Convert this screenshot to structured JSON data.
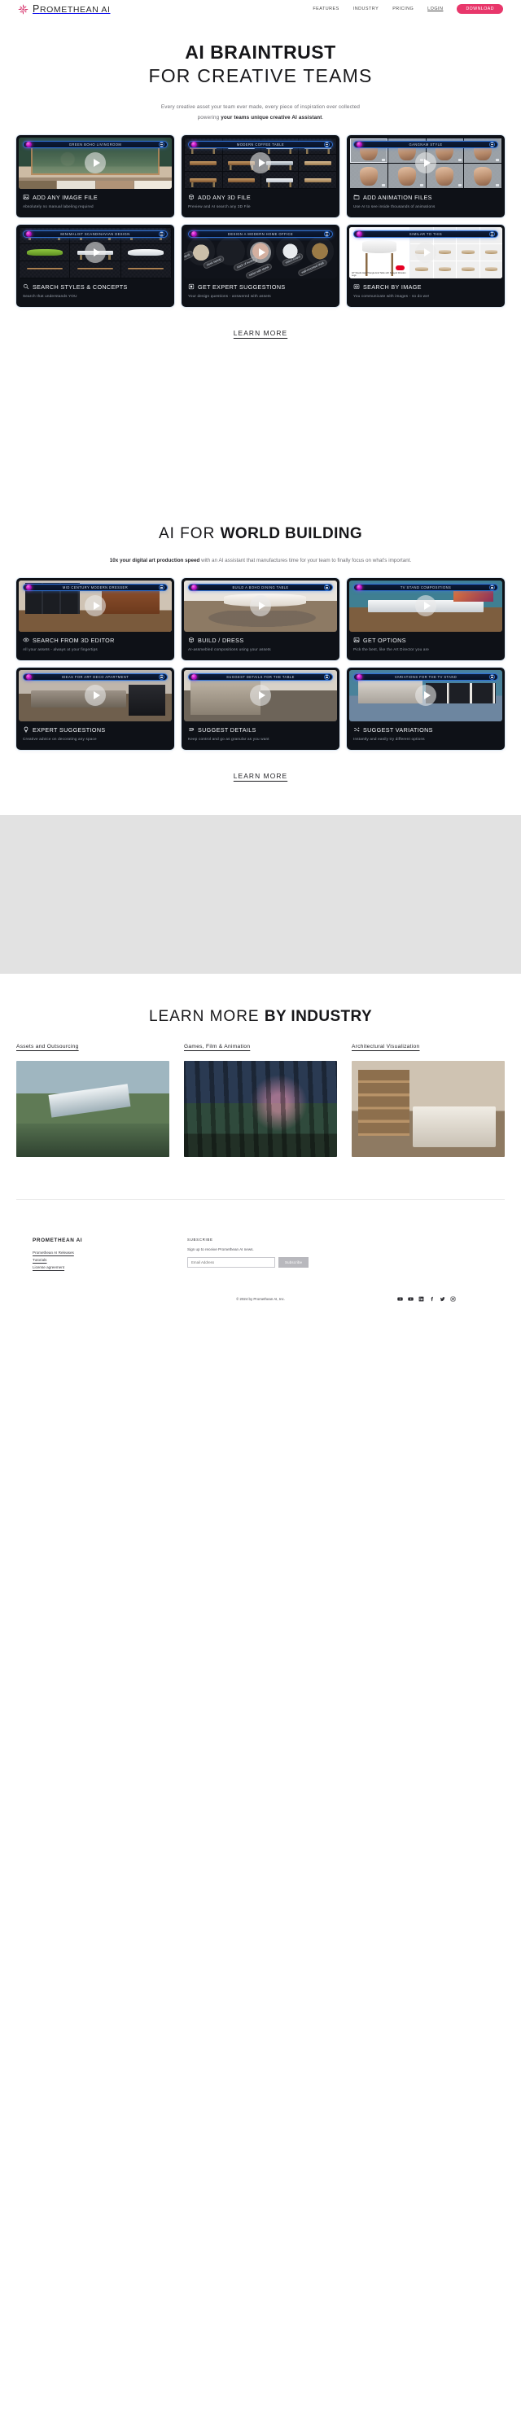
{
  "header": {
    "brand": "Promethean AI",
    "logo_icon": "promethean-flake-icon",
    "accent": "#e8376b",
    "nav": [
      {
        "label": "Features",
        "name": "features"
      },
      {
        "label": "Industry",
        "name": "industry"
      },
      {
        "label": "Pricing",
        "name": "pricing"
      },
      {
        "label": "Login",
        "name": "login",
        "underlined": true
      }
    ],
    "cta": "Download"
  },
  "hero": {
    "title_line1": "AI BRAINTRUST",
    "title_line2": "FOR CREATIVE TEAMS",
    "lede_part1": "Every creative asset your team ever made, every piece of inspiration ever collected",
    "lede_part2": "powering ",
    "lede_bold": "your teams unique creative AI assistant",
    "lede_part3": "."
  },
  "braintrust_cards": [
    {
      "window_title": "Green Boho Livingroom",
      "title": "Add Any Image File",
      "subtitle": "Absolutely no manual labeling required",
      "icon": "image-icon"
    },
    {
      "window_title": "Modern Coffee Table",
      "title": "Add Any 3D File",
      "subtitle": "Preview and AI search any 3D File",
      "icon": "cube-icon"
    },
    {
      "window_title": "Gangnam Style",
      "title": "Add Animation Files",
      "subtitle": "Use AI to see inside thousands of animations",
      "icon": "clapperboard-icon"
    },
    {
      "window_title": "Minimalist Scandinavian Design",
      "title": "Search Styles & Concepts",
      "subtitle": "Search that understands YOU",
      "icon": "magnifier-icon"
    },
    {
      "window_title": "Design A Modern Home Office",
      "title": "Get Expert Suggestions",
      "subtitle": "Your design questions - answered with assets",
      "icon": "aperture-icon"
    },
    {
      "window_title": "Similar To This",
      "title": "Search By Image",
      "subtitle": "You communicate with images - so do we!",
      "icon": "eye-scan-icon"
    }
  ],
  "braintrust_learn_more": "LEARN MORE",
  "world": {
    "title_light": "AI FOR ",
    "title_bold": "WORLD BUILDING",
    "sub_bold": "10x your digital art production speed",
    "sub_rest": " with an AI assistant that manufactures time for your team to finally focus on what's important."
  },
  "world_cards": [
    {
      "window_title": "Mid Century Modern Dresser",
      "title": "Search From 3D Editor",
      "subtitle": "All your assets - always at your fingertips",
      "icon": "eye-icon"
    },
    {
      "window_title": "Build A Boho Dining Table",
      "title": "Build / Dress",
      "subtitle": "AI-assmebled compositions using your assets",
      "icon": "cube-icon"
    },
    {
      "window_title": "TV Stand Compositions",
      "title": "Get Options",
      "subtitle": "Pick the best, like the Art Director you are",
      "icon": "image-icon"
    },
    {
      "window_title": "Ideas For Art Deco Apartment",
      "title": "Expert Suggestions",
      "subtitle": "Creative advice on decorating any space",
      "icon": "bulb-icon"
    },
    {
      "window_title": "Suggest Details For The Table",
      "title": "Suggest Details",
      "subtitle": "Keep control and go as granular as you want",
      "icon": "details-icon"
    },
    {
      "window_title": "Variations For The TV Stand",
      "title": "Suggest Variations",
      "subtitle": "Instantly and easily try different options",
      "icon": "shuffle-icon"
    }
  ],
  "world_learn_more": "LEARN MORE",
  "industry": {
    "title_light": "LEARN MORE ",
    "title_bold": "BY INDUSTRY",
    "columns": [
      {
        "label": "Assets and Outsourcing",
        "name": "assets-and-outsourcing"
      },
      {
        "label": "Games, Film & Animation",
        "name": "games-film-animation"
      },
      {
        "label": "Architectural Visualization",
        "name": "architectural-visualization"
      }
    ]
  },
  "footer": {
    "brand": "PROMETHEAN AI",
    "links": [
      "Promethean AI Releases",
      "Tutorials",
      "License agreement"
    ],
    "subscribe_heading": "SUBSCRIBE",
    "subscribe_note": "Sign up to receive Promethean AI news.",
    "email_placeholder": "Email Address",
    "email_value": "",
    "subscribe_button": "Subscribe",
    "copyright": "© 2024 by Promethean AI, Inc.",
    "socials": [
      "youtube-icon",
      "youtube-play-icon",
      "linkedin-icon",
      "facebook-icon",
      "twitter-icon",
      "instagram-icon"
    ]
  }
}
